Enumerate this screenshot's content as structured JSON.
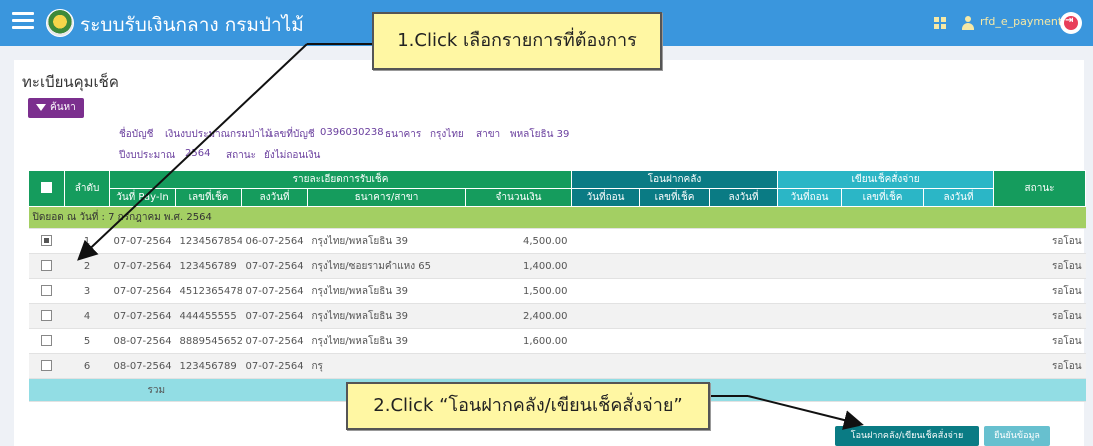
{
  "app": {
    "title": "ระบบรับเงินกลาง กรมป่าไม้",
    "username": "rfd_e_payment"
  },
  "page": {
    "title": "ทะเบียนคุมเช็ค",
    "search_label": "ค้นหา"
  },
  "info": {
    "account_name_label": "ชื่อบัญชี",
    "account_name": "เงินงบประมาณกรมป่าไม้",
    "account_no_label": "เลขที่บัญชี",
    "account_no": "0396030238",
    "bank_label": "ธนาคาร",
    "bank": "กรุงไทย",
    "branch_label": "สาขา",
    "branch": "พหลโยธิน 39",
    "fiscal_year_label": "ปีงบประมาณ",
    "fiscal_year": "2564",
    "status_label": "สถานะ",
    "status": "ยังไม่ถอนเงิน"
  },
  "table": {
    "headers": {
      "seq": "ลำดับ",
      "group_receive": "รายละเอียดการรับเช็ค",
      "group_transfer": "โอนฝากคลัง",
      "group_cheque": "เขียนเช็คสั่งจ่าย",
      "status": "สถานะ",
      "payin_date": "วันที่ Pay-In",
      "cheque_no": "เลขที่เช็ค",
      "dated": "ลงวันที่",
      "bank_branch": "ธนาคาร/สาขา",
      "amount": "จำนวนเงิน",
      "t_withdraw_date": "วันที่ถอน",
      "t_cheque_no": "เลขที่เช็ค",
      "t_dated": "ลงวันที่",
      "c_withdraw_date": "วันที่ถอน",
      "c_cheque_no": "เลขที่เช็ค",
      "c_dated": "ลงวันที่"
    },
    "group_row": "ปิดยอด ณ วันที่ : 7 กรกฎาคม พ.ศ. 2564",
    "rows": [
      {
        "checked": true,
        "seq": "1",
        "payin": "07-07-2564",
        "cheque": "1234567854",
        "dated": "06-07-2564",
        "bank": "กรุงไทย/พหลโยธิน 39",
        "amount": "4,500.00",
        "status": "รอโอน"
      },
      {
        "checked": false,
        "seq": "2",
        "payin": "07-07-2564",
        "cheque": "123456789",
        "dated": "07-07-2564",
        "bank": "กรุงไทย/ซอยรามคำแหง 65",
        "amount": "1,400.00",
        "status": "รอโอน"
      },
      {
        "checked": false,
        "seq": "3",
        "payin": "07-07-2564",
        "cheque": "4512365478",
        "dated": "07-07-2564",
        "bank": "กรุงไทย/พหลโยธิน 39",
        "amount": "1,500.00",
        "status": "รอโอน"
      },
      {
        "checked": false,
        "seq": "4",
        "payin": "07-07-2564",
        "cheque": "444455555",
        "dated": "07-07-2564",
        "bank": "กรุงไทย/พหลโยธิน 39",
        "amount": "2,400.00",
        "status": "รอโอน"
      },
      {
        "checked": false,
        "seq": "5",
        "payin": "08-07-2564",
        "cheque": "8889545652",
        "dated": "07-07-2564",
        "bank": "กรุงไทย/พหลโยธิน 39",
        "amount": "1,600.00",
        "status": "รอโอน"
      },
      {
        "checked": false,
        "seq": "6",
        "payin": "08-07-2564",
        "cheque": "123456789",
        "dated": "07-07-2564",
        "bank": "กรุ",
        "amount": "",
        "status": "รอโอน"
      }
    ],
    "total_label": "รวม"
  },
  "buttons": {
    "transfer": "โอนฝากคลัง/เขียนเช็คสั่งจ่าย",
    "confirm": "ยืนยันข้อมูล"
  },
  "callouts": {
    "step1": "1.Click เลือกรายการที่ต้องการ",
    "step2": "2.Click “โอนฝากคลัง/เขียนเช็คสั่งจ่าย”"
  },
  "colors": {
    "topbar": "#3a96dd",
    "header_green": "#159c5d",
    "header_teal": "#0a7b84",
    "header_cyan": "#2bb6c6",
    "group_row": "#a3cf63",
    "total_row": "#92dde4",
    "search_button": "#7b2f8e",
    "callout": "#fff7a3"
  }
}
